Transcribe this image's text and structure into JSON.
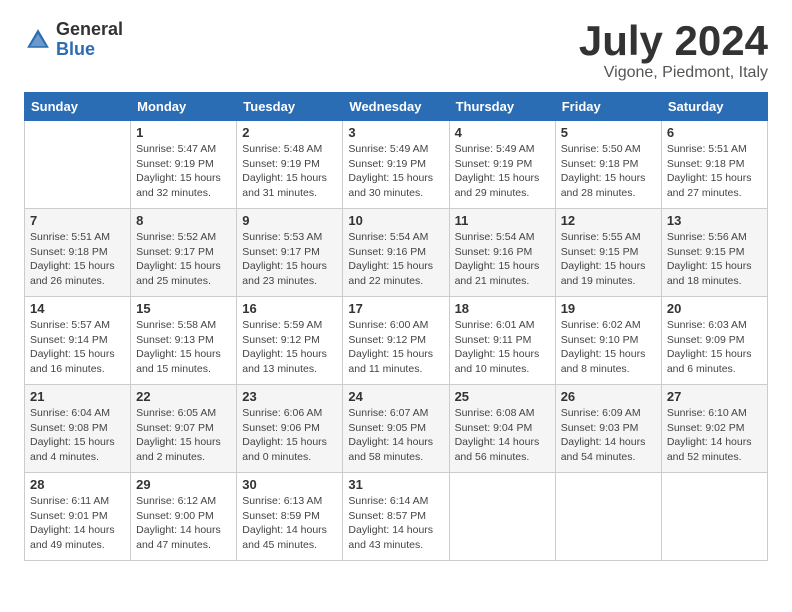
{
  "header": {
    "logo_general": "General",
    "logo_blue": "Blue",
    "month": "July 2024",
    "location": "Vigone, Piedmont, Italy"
  },
  "days_of_week": [
    "Sunday",
    "Monday",
    "Tuesday",
    "Wednesday",
    "Thursday",
    "Friday",
    "Saturday"
  ],
  "weeks": [
    [
      {
        "day": "",
        "info": ""
      },
      {
        "day": "1",
        "info": "Sunrise: 5:47 AM\nSunset: 9:19 PM\nDaylight: 15 hours\nand 32 minutes."
      },
      {
        "day": "2",
        "info": "Sunrise: 5:48 AM\nSunset: 9:19 PM\nDaylight: 15 hours\nand 31 minutes."
      },
      {
        "day": "3",
        "info": "Sunrise: 5:49 AM\nSunset: 9:19 PM\nDaylight: 15 hours\nand 30 minutes."
      },
      {
        "day": "4",
        "info": "Sunrise: 5:49 AM\nSunset: 9:19 PM\nDaylight: 15 hours\nand 29 minutes."
      },
      {
        "day": "5",
        "info": "Sunrise: 5:50 AM\nSunset: 9:18 PM\nDaylight: 15 hours\nand 28 minutes."
      },
      {
        "day": "6",
        "info": "Sunrise: 5:51 AM\nSunset: 9:18 PM\nDaylight: 15 hours\nand 27 minutes."
      }
    ],
    [
      {
        "day": "7",
        "info": "Sunrise: 5:51 AM\nSunset: 9:18 PM\nDaylight: 15 hours\nand 26 minutes."
      },
      {
        "day": "8",
        "info": "Sunrise: 5:52 AM\nSunset: 9:17 PM\nDaylight: 15 hours\nand 25 minutes."
      },
      {
        "day": "9",
        "info": "Sunrise: 5:53 AM\nSunset: 9:17 PM\nDaylight: 15 hours\nand 23 minutes."
      },
      {
        "day": "10",
        "info": "Sunrise: 5:54 AM\nSunset: 9:16 PM\nDaylight: 15 hours\nand 22 minutes."
      },
      {
        "day": "11",
        "info": "Sunrise: 5:54 AM\nSunset: 9:16 PM\nDaylight: 15 hours\nand 21 minutes."
      },
      {
        "day": "12",
        "info": "Sunrise: 5:55 AM\nSunset: 9:15 PM\nDaylight: 15 hours\nand 19 minutes."
      },
      {
        "day": "13",
        "info": "Sunrise: 5:56 AM\nSunset: 9:15 PM\nDaylight: 15 hours\nand 18 minutes."
      }
    ],
    [
      {
        "day": "14",
        "info": "Sunrise: 5:57 AM\nSunset: 9:14 PM\nDaylight: 15 hours\nand 16 minutes."
      },
      {
        "day": "15",
        "info": "Sunrise: 5:58 AM\nSunset: 9:13 PM\nDaylight: 15 hours\nand 15 minutes."
      },
      {
        "day": "16",
        "info": "Sunrise: 5:59 AM\nSunset: 9:12 PM\nDaylight: 15 hours\nand 13 minutes."
      },
      {
        "day": "17",
        "info": "Sunrise: 6:00 AM\nSunset: 9:12 PM\nDaylight: 15 hours\nand 11 minutes."
      },
      {
        "day": "18",
        "info": "Sunrise: 6:01 AM\nSunset: 9:11 PM\nDaylight: 15 hours\nand 10 minutes."
      },
      {
        "day": "19",
        "info": "Sunrise: 6:02 AM\nSunset: 9:10 PM\nDaylight: 15 hours\nand 8 minutes."
      },
      {
        "day": "20",
        "info": "Sunrise: 6:03 AM\nSunset: 9:09 PM\nDaylight: 15 hours\nand 6 minutes."
      }
    ],
    [
      {
        "day": "21",
        "info": "Sunrise: 6:04 AM\nSunset: 9:08 PM\nDaylight: 15 hours\nand 4 minutes."
      },
      {
        "day": "22",
        "info": "Sunrise: 6:05 AM\nSunset: 9:07 PM\nDaylight: 15 hours\nand 2 minutes."
      },
      {
        "day": "23",
        "info": "Sunrise: 6:06 AM\nSunset: 9:06 PM\nDaylight: 15 hours\nand 0 minutes."
      },
      {
        "day": "24",
        "info": "Sunrise: 6:07 AM\nSunset: 9:05 PM\nDaylight: 14 hours\nand 58 minutes."
      },
      {
        "day": "25",
        "info": "Sunrise: 6:08 AM\nSunset: 9:04 PM\nDaylight: 14 hours\nand 56 minutes."
      },
      {
        "day": "26",
        "info": "Sunrise: 6:09 AM\nSunset: 9:03 PM\nDaylight: 14 hours\nand 54 minutes."
      },
      {
        "day": "27",
        "info": "Sunrise: 6:10 AM\nSunset: 9:02 PM\nDaylight: 14 hours\nand 52 minutes."
      }
    ],
    [
      {
        "day": "28",
        "info": "Sunrise: 6:11 AM\nSunset: 9:01 PM\nDaylight: 14 hours\nand 49 minutes."
      },
      {
        "day": "29",
        "info": "Sunrise: 6:12 AM\nSunset: 9:00 PM\nDaylight: 14 hours\nand 47 minutes."
      },
      {
        "day": "30",
        "info": "Sunrise: 6:13 AM\nSunset: 8:59 PM\nDaylight: 14 hours\nand 45 minutes."
      },
      {
        "day": "31",
        "info": "Sunrise: 6:14 AM\nSunset: 8:57 PM\nDaylight: 14 hours\nand 43 minutes."
      },
      {
        "day": "",
        "info": ""
      },
      {
        "day": "",
        "info": ""
      },
      {
        "day": "",
        "info": ""
      }
    ]
  ]
}
